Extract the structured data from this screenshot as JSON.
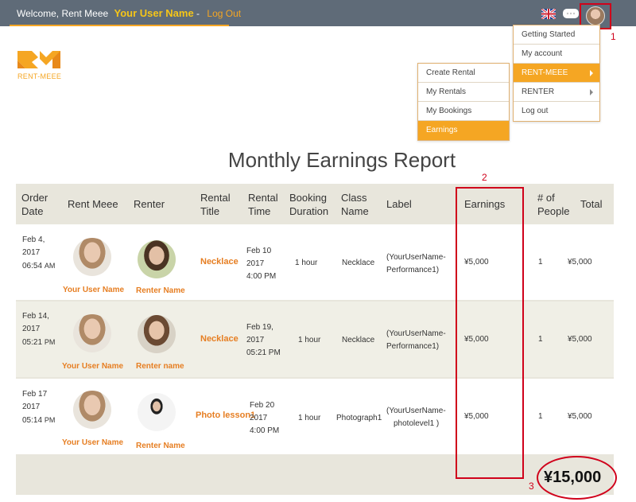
{
  "topbar": {
    "welcome_text": "Welcome, Rent Meee",
    "user_name": "Your User Name",
    "separator": "-",
    "logout_label": "Log Out"
  },
  "logo": {
    "text": "RENT-MEEE",
    "brand_color": "#f5a623"
  },
  "annotations": {
    "n1": "1",
    "n2": "2",
    "n3": "3"
  },
  "account_menu": {
    "items": [
      {
        "label": "Getting Started"
      },
      {
        "label": "My account"
      },
      {
        "label": "RENT-MEEE"
      },
      {
        "label": "RENTER"
      },
      {
        "label": "Log out"
      }
    ]
  },
  "rentmeee_submenu": {
    "items": [
      {
        "label": "Create Rental"
      },
      {
        "label": "My Rentals"
      },
      {
        "label": "My Bookings"
      },
      {
        "label": "Earnings"
      }
    ]
  },
  "report": {
    "title": "Monthly Earnings Report",
    "headers": {
      "order_date": "Order Date",
      "rent_meee": "Rent Meee",
      "renter": "Renter",
      "rental_title": "Rental Title",
      "rental_time": "Rental Time",
      "booking_duration": "Booking Duration",
      "class_name": "Class Name",
      "label": "Label",
      "earnings": "Earnings",
      "people": "# of People",
      "total": "Total"
    },
    "rows": [
      {
        "date": "Feb 4,",
        "year": "2017",
        "time": "06:54",
        "ampm": "AM",
        "rent_meee_name": "Your User Name",
        "renter_name": "Renter Name",
        "rental_title": "Necklace",
        "rental_date": "Feb 10",
        "rental_year": "2017",
        "rental_time": "4:00 PM",
        "duration": "1 hour",
        "class_name": "Necklace",
        "label_line1": "(YourUserName-",
        "label_line2": "Performance1)",
        "earnings": "¥5,000",
        "people": "1",
        "total": "¥5,000"
      },
      {
        "date": "Feb 14,",
        "year": "2017",
        "time": "05:21",
        "ampm": "PM",
        "rent_meee_name": "Your User Name",
        "renter_name": "Renter name",
        "rental_title": "Necklace",
        "rental_date": "Feb 19,",
        "rental_year": "2017",
        "rental_time": "05:21 PM",
        "duration": "1 hour",
        "class_name": "Necklace",
        "label_line1": "(YourUserName-",
        "label_line2": "Performance1)",
        "earnings": "¥5,000",
        "people": "1",
        "total": "¥5,000"
      },
      {
        "date": "Feb 17",
        "year": "2017",
        "time": "05:14",
        "ampm": "PM",
        "rent_meee_name": "Your User Name",
        "renter_name": "Renter Name",
        "rental_title": "Photo lesson1",
        "rental_date": "Feb 20",
        "rental_year": "2017",
        "rental_time": "4:00 PM",
        "duration": "1 hour",
        "class_name": "Photograph1",
        "label_line1": "(YourUserName-",
        "label_line2": "photolevel1 )",
        "earnings": "¥5,000",
        "people": "1",
        "total": "¥5,000"
      }
    ],
    "grand_total": "¥15,000"
  },
  "colors": {
    "topbar": "#5f6b78",
    "accent": "#f5a623",
    "link": "#e67e22",
    "annotation": "#d0021b"
  }
}
